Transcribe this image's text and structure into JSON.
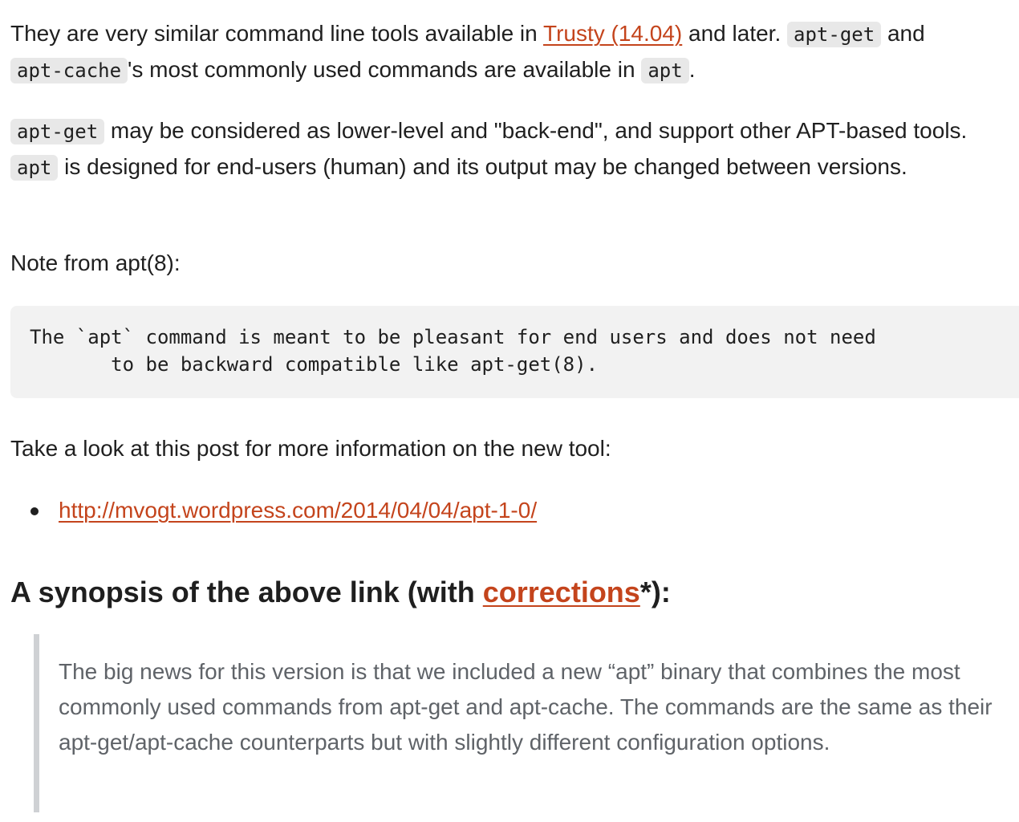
{
  "para1": {
    "t1": "They are very similar command line tools available in ",
    "link_trusty": "Trusty (14.04)",
    "t2": " and later. ",
    "code_apt_get": "apt-get",
    "t3": " and ",
    "code_apt_cache": "apt-cache",
    "t4": "'s most commonly used commands are available in ",
    "code_apt": "apt",
    "t5": "."
  },
  "para2": {
    "code_apt_get": "apt-get",
    "t1": " may be considered as lower-level and \"back-end\", and support other APT-based tools. ",
    "code_apt": "apt",
    "t2": " is designed for end-users (human) and its output may be changed between versions."
  },
  "para3": {
    "text": "Note from apt(8):"
  },
  "codeblock": {
    "text": "The `apt` command is meant to be pleasant for end users and does not need\n       to be backward compatible like apt-get(8)."
  },
  "para4": {
    "text": "Take a look at this post for more information on the new tool:"
  },
  "links": [
    {
      "label": "http://mvogt.wordpress.com/2014/04/04/apt-1-0/"
    }
  ],
  "heading": {
    "t1": "A synopsis of the above link (with ",
    "link": "corrections",
    "t2": "*):"
  },
  "blockquote": {
    "text": "The big news for this version is that we included a new “apt” binary that combines the most commonly used commands from apt-get and apt-cache. The commands are the same as their apt-get/apt-cache counterparts but with slightly different configuration options."
  },
  "colors": {
    "link": "#c4441c",
    "text": "#1f1f1f",
    "code_bg": "#e8e8e8",
    "codeblock_bg": "#f2f2f2",
    "quote_border": "#cfd1d4",
    "quote_text": "#5f6368"
  }
}
